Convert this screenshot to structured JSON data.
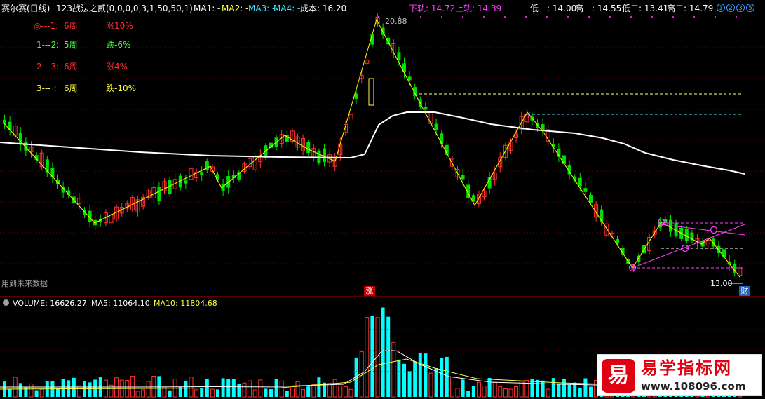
{
  "header": {
    "stock_name": "赛尔赛(日线)",
    "indicator": "123战法之贰(0,0,0,0,3,1,50,50,1)",
    "ma1": "MA1: -",
    "ma2": "MA2: -",
    "ma3": "MA3: -",
    "ma4": "MA4: -",
    "cost": "成本: 16.20",
    "lower_track": "下轨: 14.72",
    "upper_track": "上轨: 14.39",
    "low1": "低一: 14.00",
    "high1": "高一: 14.55",
    "low2": "低二: 13.41",
    "high2": "高二: 14.79",
    "circle_buttons": [
      "1",
      "2",
      "3",
      "5"
    ]
  },
  "legend": [
    {
      "label": "◎---1:",
      "period": "6周",
      "change": "涨10%",
      "color": "#ff3030"
    },
    {
      "label": "1---2:",
      "period": "5周",
      "change": "跌-6%",
      "color": "#40ff40"
    },
    {
      "label": "2---3:",
      "period": "6周",
      "change": "涨4%",
      "color": "#ff3030"
    },
    {
      "label": "3---  :",
      "period": "6周",
      "change": "跌-10%",
      "color": "#ffff40"
    }
  ],
  "annotations": {
    "peak_price": "20.88",
    "low_price": "13.00",
    "future_data": "用到未来数据",
    "rise_marker": "涨",
    "finance_marker": "财"
  },
  "volume": {
    "label": "VOLUME: 16626.27",
    "ma5": "MA5: 11064.10",
    "ma10": "MA10: 11804.68"
  },
  "logo": {
    "mark": "易",
    "title": "易学指标网",
    "url": "www.108096.com"
  },
  "colors": {
    "up": "#ff3232",
    "down": "#00ffff",
    "down_candle": "#00e000",
    "zigzag": "#ffff00",
    "long_ma": "#ffffff",
    "channel": "#ff40ff"
  },
  "chart_data": {
    "type": "candlestick",
    "series": [
      {
        "name": "MA1",
        "values": []
      },
      {
        "name": "MA2",
        "values": []
      }
    ],
    "swing_points": [
      20.88,
      13.0
    ]
  }
}
